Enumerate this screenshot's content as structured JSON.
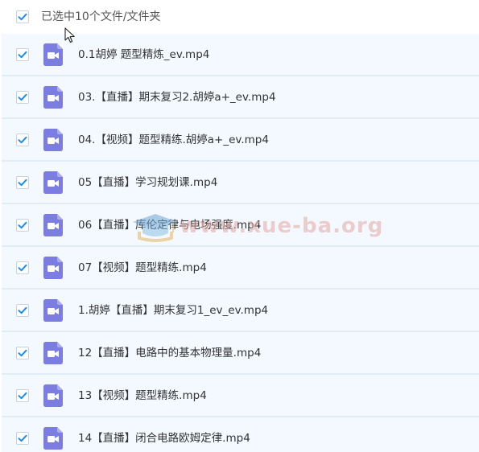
{
  "header": {
    "selected_label": "已选中10个文件/文件夹"
  },
  "files": [
    {
      "name": "0.1胡婷 题型精炼_ev.mp4"
    },
    {
      "name": "03.【直播】期末复习2.胡婷a+_ev.mp4"
    },
    {
      "name": "04.【视频】题型精练.胡婷a+_ev.mp4"
    },
    {
      "name": "05【直播】学习规划课.mp4"
    },
    {
      "name": "06【直播】库伦定律与电场强度.mp4"
    },
    {
      "name": "07【视频】题型精练.mp4"
    },
    {
      "name": "1.胡婷【直播】期末复习1_ev_ev.mp4"
    },
    {
      "name": "12【直播】电路中的基本物理量.mp4"
    },
    {
      "name": "13【视频】题型精练.mp4"
    },
    {
      "name": "14【直播】闭合电路欧姆定律.mp4"
    }
  ],
  "watermark": {
    "text": "www.xue-ba.org"
  },
  "colors": {
    "check": "#1a8cf0",
    "video_icon": "#7b7de0",
    "row_bg": "#f3f9ff",
    "row_border": "#e1ecf6",
    "text": "#333333"
  },
  "icons": {
    "check": "checkmark-icon",
    "file": "video-file-icon",
    "cursor": "mouse-cursor-icon"
  }
}
